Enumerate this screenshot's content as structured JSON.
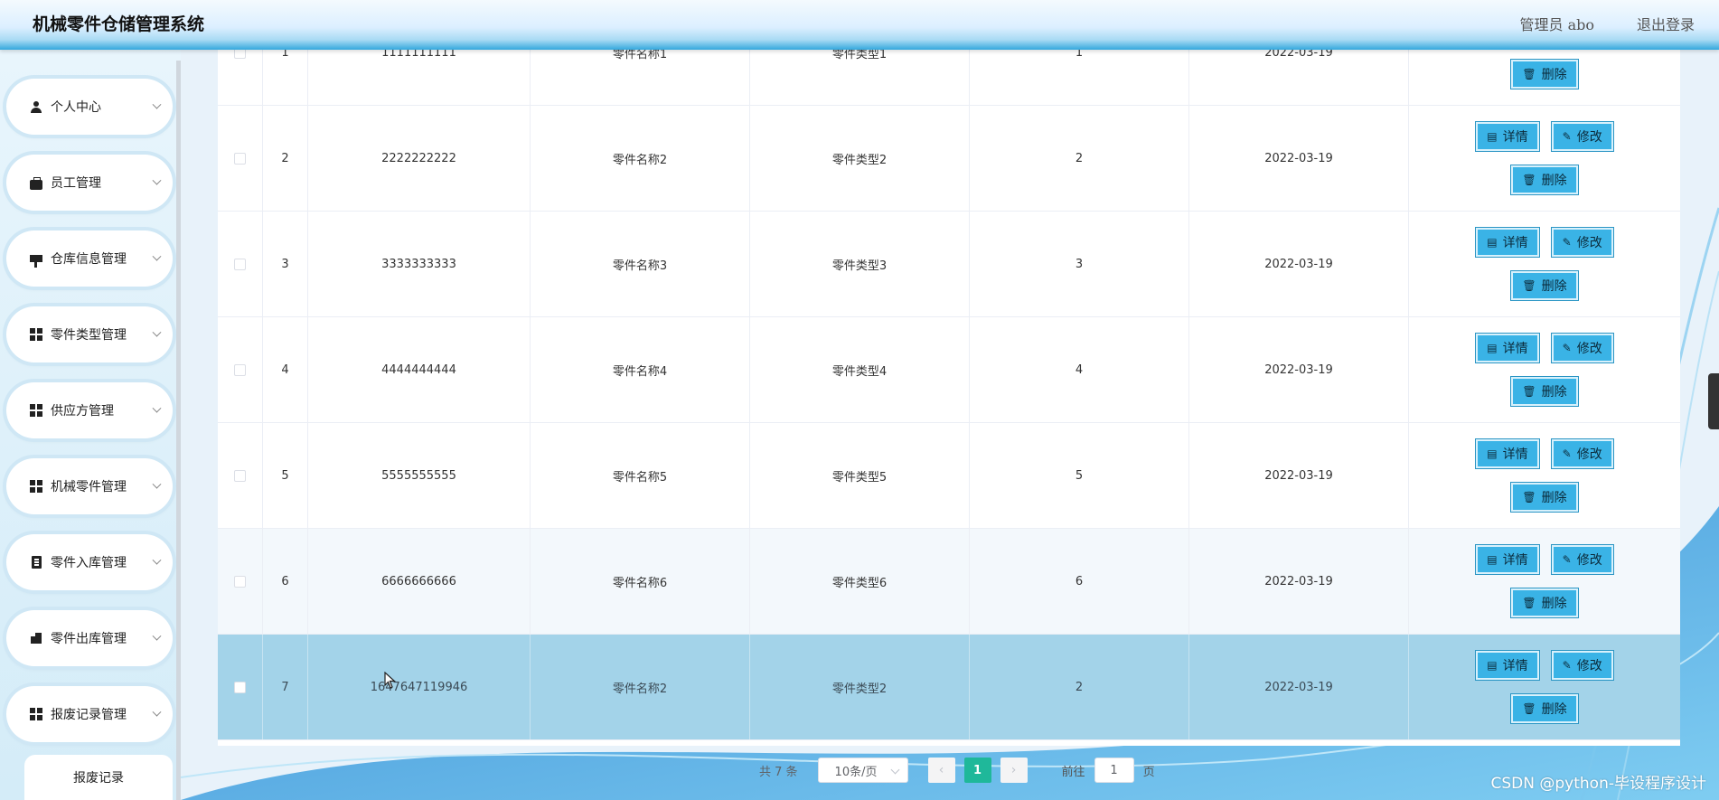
{
  "header": {
    "title": "机械零件仓储管理系统",
    "user_label": "管理员 abo",
    "logout_label": "退出登录"
  },
  "sidebar": {
    "items": [
      {
        "label": "个人中心",
        "icon": "person-icon"
      },
      {
        "label": "员工管理",
        "icon": "briefcase-icon"
      },
      {
        "label": "仓库信息管理",
        "icon": "flag-icon"
      },
      {
        "label": "零件类型管理",
        "icon": "grid-icon"
      },
      {
        "label": "供应方管理",
        "icon": "grid-icon"
      },
      {
        "label": "机械零件管理",
        "icon": "grid-icon"
      },
      {
        "label": "零件入库管理",
        "icon": "clipboard-icon"
      },
      {
        "label": "零件出库管理",
        "icon": "toolbox-icon"
      },
      {
        "label": "报废记录管理",
        "icon": "grid-icon"
      }
    ],
    "submenu_label": "报废记录"
  },
  "table": {
    "rows": [
      {
        "idx": "1",
        "no": "1111111111",
        "name": "零件名称1",
        "type": "零件类型1",
        "qty": "1",
        "date": "2022-03-19"
      },
      {
        "idx": "2",
        "no": "2222222222",
        "name": "零件名称2",
        "type": "零件类型2",
        "qty": "2",
        "date": "2022-03-19"
      },
      {
        "idx": "3",
        "no": "3333333333",
        "name": "零件名称3",
        "type": "零件类型3",
        "qty": "3",
        "date": "2022-03-19"
      },
      {
        "idx": "4",
        "no": "4444444444",
        "name": "零件名称4",
        "type": "零件类型4",
        "qty": "4",
        "date": "2022-03-19"
      },
      {
        "idx": "5",
        "no": "5555555555",
        "name": "零件名称5",
        "type": "零件类型5",
        "qty": "5",
        "date": "2022-03-19"
      },
      {
        "idx": "6",
        "no": "6666666666",
        "name": "零件名称6",
        "type": "零件类型6",
        "qty": "6",
        "date": "2022-03-19"
      },
      {
        "idx": "7",
        "no": "1647647119946",
        "name": "零件名称2",
        "type": "零件类型2",
        "qty": "2",
        "date": "2022-03-19"
      }
    ],
    "actions": {
      "detail": "详情",
      "edit": "修改",
      "delete": "删除"
    }
  },
  "pagination": {
    "total": "共 7 条",
    "page_size": "10条/页",
    "current_page": "1",
    "goto_label": "前往",
    "goto_value": "1",
    "page_unit": "页"
  },
  "watermark": "CSDN @python-毕设程序设计",
  "colors": {
    "button": "#3ab3e6",
    "active_page": "#1fb89a",
    "selected_row": "#a3d3e9"
  }
}
